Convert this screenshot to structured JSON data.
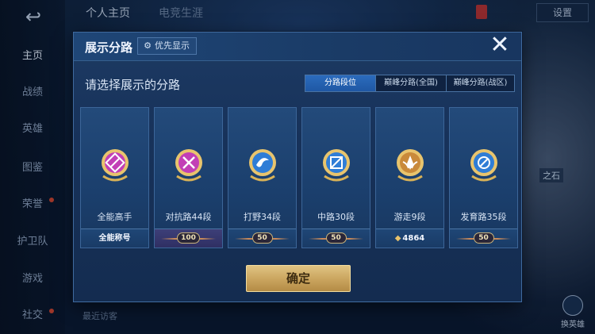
{
  "background": {
    "back_icon": "back-arrow-icon",
    "nav_items": [
      {
        "label": "主页",
        "active": true
      },
      {
        "label": "战绩"
      },
      {
        "label": "英雄"
      },
      {
        "label": "图鉴"
      },
      {
        "label": "荣誉"
      },
      {
        "label": "护卫队"
      },
      {
        "label": "游戏"
      },
      {
        "label": "社交"
      }
    ],
    "top_tabs": [
      "个人主页",
      "电竞生涯"
    ],
    "settings_label": "设置",
    "footer_text": "最近访客",
    "swap_hero_label": "换英雄",
    "hero_label": "之石"
  },
  "modal": {
    "title": "展示分路",
    "priority_label": "优先显示",
    "priority_icon": "gear-icon",
    "close_icon": "close-icon",
    "prompt": "请选择展示的分路",
    "mode_tabs": [
      {
        "label": "分路段位",
        "active": true
      },
      {
        "label": "巅峰分路(全国)"
      },
      {
        "label": "巅峰分路(战区)"
      }
    ],
    "cards": [
      {
        "name": "全能高手",
        "footer_text": "全能称号",
        "badge_color": "#c23fb6",
        "badge_symbol": "rank-all-icon"
      },
      {
        "name": "对抗路44段",
        "footer_pill": "100",
        "badge_color": "#c23fb6",
        "badge_symbol": "rank-clash-icon"
      },
      {
        "name": "打野34段",
        "footer_pill": "50",
        "badge_color": "#2f7dd6",
        "badge_symbol": "rank-jungle-icon"
      },
      {
        "name": "中路30段",
        "footer_pill": "50",
        "badge_color": "#2f7dd6",
        "badge_symbol": "rank-mid-icon"
      },
      {
        "name": "游走9段",
        "footer_score": "4864",
        "badge_color": "#c98a3a",
        "badge_symbol": "rank-roam-icon"
      },
      {
        "name": "发育路35段",
        "footer_pill": "50",
        "badge_color": "#2f7dd6",
        "badge_symbol": "rank-farm-icon"
      }
    ],
    "confirm_label": "确定"
  }
}
